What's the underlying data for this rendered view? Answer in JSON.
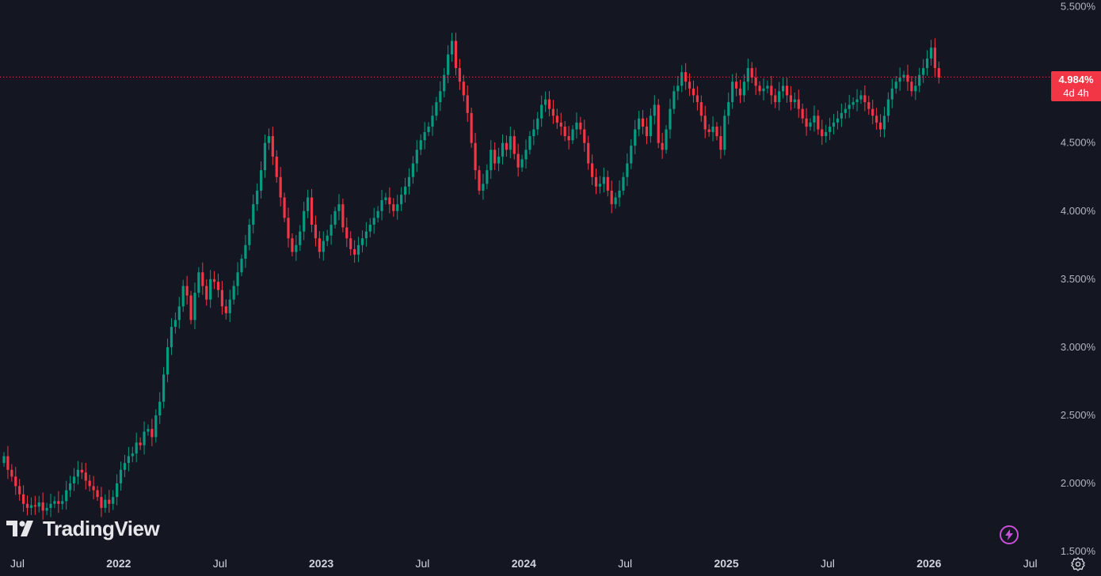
{
  "branding": {
    "logo_text": "TradingView"
  },
  "current_price": {
    "value": 4.984,
    "label": "4.984%",
    "countdown": "4d 4h",
    "badge_color": "#f23645"
  },
  "colors": {
    "background": "#141722",
    "up": "#089981",
    "down": "#f23645",
    "axis_text": "#b2b5be"
  },
  "icons": {
    "bolt": "lightning-icon",
    "settings": "gear-icon"
  },
  "chart_data": {
    "type": "candlestick",
    "title": "",
    "xlabel": "",
    "ylabel": "",
    "ylim": [
      1.32,
      5.55
    ],
    "grid": false,
    "y_ticks": [
      "5.500%",
      "4.500%",
      "4.000%",
      "3.500%",
      "3.000%",
      "2.500%",
      "2.000%",
      "1.500%"
    ],
    "y_tick_values": [
      5.5,
      4.5,
      4.0,
      3.5,
      3.0,
      2.5,
      2.0,
      1.5
    ],
    "x_ticks": [
      {
        "label": "Jul",
        "week": 0,
        "year": false
      },
      {
        "label": "2022",
        "week": 26,
        "year": true
      },
      {
        "label": "Jul",
        "week": 52,
        "year": false
      },
      {
        "label": "2023",
        "week": 78,
        "year": true
      },
      {
        "label": "Jul",
        "week": 104,
        "year": false
      },
      {
        "label": "2024",
        "week": 130,
        "year": true
      },
      {
        "label": "Jul",
        "week": 156,
        "year": false
      },
      {
        "label": "2025",
        "week": 182,
        "year": true
      },
      {
        "label": "Jul",
        "week": 208,
        "year": false
      },
      {
        "label": "2026",
        "week": 234,
        "year": true
      },
      {
        "label": "Jul",
        "week": 260,
        "year": false
      }
    ],
    "interval": "1W",
    "start": "2021-07",
    "closes": [
      2.2,
      2.1,
      2.05,
      1.98,
      1.92,
      1.85,
      1.82,
      1.84,
      1.83,
      1.86,
      1.8,
      1.82,
      1.85,
      1.87,
      1.85,
      1.87,
      1.95,
      2.0,
      2.05,
      2.1,
      2.08,
      2.02,
      1.98,
      1.95,
      1.9,
      1.82,
      1.88,
      1.85,
      1.9,
      2.0,
      2.1,
      2.15,
      2.2,
      2.22,
      2.3,
      2.28,
      2.38,
      2.4,
      2.34,
      2.5,
      2.6,
      2.8,
      3.0,
      3.15,
      3.2,
      3.3,
      3.45,
      3.38,
      3.2,
      3.4,
      3.55,
      3.45,
      3.35,
      3.5,
      3.48,
      3.42,
      3.3,
      3.25,
      3.35,
      3.45,
      3.55,
      3.65,
      3.75,
      3.9,
      4.05,
      4.15,
      4.3,
      4.5,
      4.55,
      4.4,
      4.25,
      4.1,
      3.95,
      3.8,
      3.7,
      3.75,
      3.85,
      4.0,
      4.1,
      3.9,
      3.8,
      3.7,
      3.78,
      3.82,
      3.9,
      4.0,
      4.05,
      3.88,
      3.8,
      3.72,
      3.68,
      3.75,
      3.8,
      3.85,
      3.9,
      3.95,
      4.0,
      4.08,
      4.1,
      4.05,
      4.0,
      4.05,
      4.12,
      4.18,
      4.25,
      4.35,
      4.45,
      4.52,
      4.58,
      4.62,
      4.7,
      4.8,
      4.88,
      5.0,
      5.15,
      5.25,
      5.05,
      4.95,
      4.85,
      4.72,
      4.5,
      4.3,
      4.15,
      4.2,
      4.3,
      4.45,
      4.35,
      4.4,
      4.5,
      4.45,
      4.55,
      4.42,
      4.32,
      4.38,
      4.45,
      4.55,
      4.6,
      4.68,
      4.78,
      4.82,
      4.75,
      4.7,
      4.65,
      4.62,
      4.55,
      4.52,
      4.6,
      4.65,
      4.6,
      4.5,
      4.35,
      4.25,
      4.18,
      4.2,
      4.25,
      4.15,
      4.05,
      4.1,
      4.15,
      4.25,
      4.35,
      4.48,
      4.6,
      4.68,
      4.62,
      4.55,
      4.7,
      4.78,
      4.5,
      4.45,
      4.6,
      4.75,
      4.88,
      4.92,
      5.02,
      4.95,
      4.9,
      4.85,
      4.8,
      4.7,
      4.6,
      4.58,
      4.62,
      4.55,
      4.45,
      4.7,
      4.8,
      4.95,
      4.9,
      4.85,
      4.95,
      5.05,
      4.98,
      4.92,
      4.88,
      4.9,
      4.92,
      4.85,
      4.8,
      4.88,
      4.92,
      4.85,
      4.8,
      4.82,
      4.75,
      4.68,
      4.62,
      4.65,
      4.7,
      4.6,
      4.55,
      4.58,
      4.62,
      4.65,
      4.68,
      4.72,
      4.75,
      4.78,
      4.8,
      4.82,
      4.85,
      4.8,
      4.75,
      4.7,
      4.65,
      4.6,
      4.7,
      4.82,
      4.9,
      4.95,
      4.98,
      5.0,
      4.95,
      4.88,
      4.92,
      5.0,
      5.05,
      5.12,
      5.2,
      5.05,
      4.98
    ]
  }
}
